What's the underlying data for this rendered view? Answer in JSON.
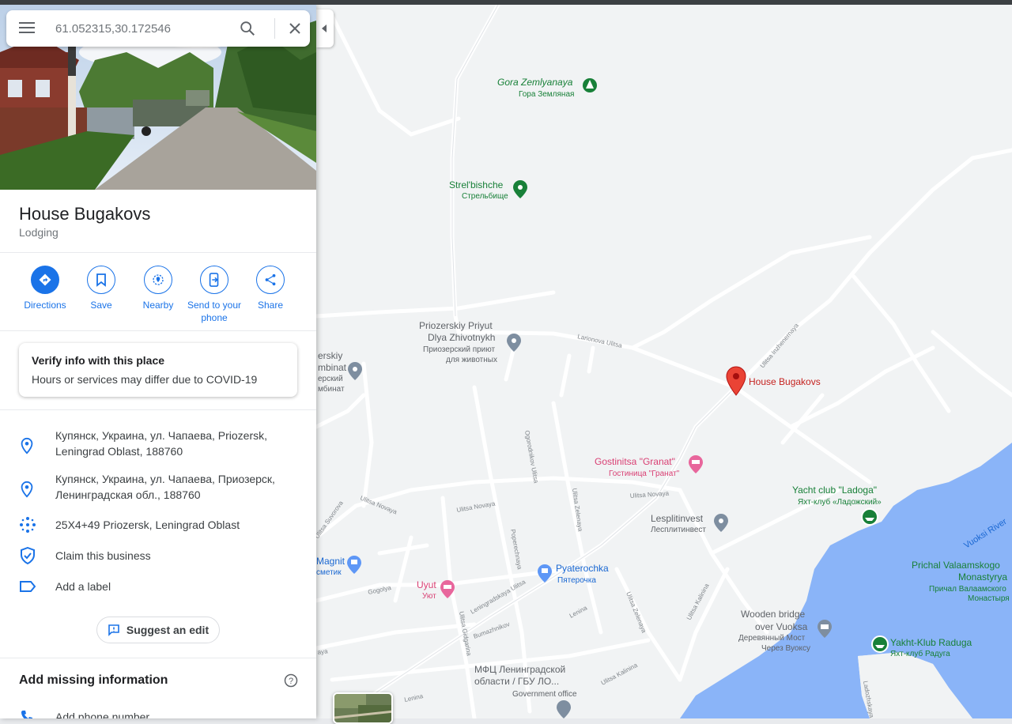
{
  "search": {
    "placeholder": "61.052315,30.172546"
  },
  "place": {
    "title": "House Bugakovs",
    "category": "Lodging"
  },
  "actions": [
    {
      "label": "Directions"
    },
    {
      "label": "Save"
    },
    {
      "label": "Nearby"
    },
    {
      "label": "Send to your\nphone"
    },
    {
      "label": "Share"
    }
  ],
  "verify": {
    "title": "Verify info with this place",
    "subtitle": "Hours or services may differ due to COVID-19"
  },
  "info": {
    "address_en": "Купянск, Украина, ул. Чапаева, Priozersk, Leningrad Oblast, 188760",
    "address_ru": "Купянск, Украина, ул. Чапаева, Приозерск, Ленинградская обл., 188760",
    "plus_code": "25X4+49 Priozersk, Leningrad Oblast",
    "claim": "Claim this business",
    "label": "Add a label"
  },
  "suggest_edit": "Suggest an edit",
  "missing": {
    "title": "Add missing information",
    "add_phone": "Add phone number"
  },
  "map": {
    "pois": {
      "gora_en": "Gora Zemlyanaya",
      "gora_ru": "Гора Земляная",
      "strel_en": "Strel'bishche",
      "strel_ru": "Стрельбище",
      "priyut_en1": "Priozerskiy Priyut",
      "priyut_en2": "Dlya Zhivotnykh",
      "priyut_ru1": "Приозерский приют",
      "priyut_ru2": "для животных",
      "kombinat_1": "erskiy",
      "kombinat_2": "mbinat",
      "kombinat_3": "ерский",
      "kombinat_4": "мбинат",
      "house": "House Bugakovs",
      "granat_en": "Gostinitsa \"Granat\"",
      "granat_ru": "Гостиница \"Гранат\"",
      "yacht_en": "Yacht club \"Ladoga\"",
      "yacht_ru": "Яхт-клуб «Ладожский»",
      "lesplit_en": "Lesplitinvest",
      "lesplit_ru": "Лесплитинвест",
      "magnit_en": "Magnit",
      "magnit_ru": "сметик",
      "pyat_en": "Pyaterochka",
      "pyat_ru": "Пятерочка",
      "uyut_en": "Uyut",
      "uyut_ru": "Уют",
      "bridge_en1": "Wooden bridge",
      "bridge_en2": "over Vuoksa",
      "bridge_ru1": "Деревянный Мост",
      "bridge_ru2": "Через Вуоксу",
      "raduga_en": "Yakht-Klub Raduga",
      "raduga_ru": "Яхт-клуб Радуга",
      "prichal_en1": "Prichal Valaamskogo",
      "prichal_en2": "Monastyrya",
      "prichal_ru1": "Причал Валаамского",
      "prichal_ru2": "Монастыря",
      "mfc_1": "МФЦ Ленинградской",
      "mfc_2": "области / ГБУ ЛО...",
      "mfc_3": "Government office",
      "river": "Vuoksi River"
    },
    "streets": {
      "larionova": "Larionova Ulitsa",
      "inzhenernaya": "Ulitsa Inzhenernaya",
      "ogorodnaya": "Ogorodnikov Ulitsa",
      "novaya1": "Ulitsa Novaya",
      "novaya2": "Ulitsa Novaya",
      "novaya3": "Ulitsa Novaya",
      "suvorova": "Ulitsa Suvorova",
      "zelenaya1": "Ulitsa Zelenaya",
      "zelenaya2": "Ulitsa Zelenaya",
      "poperechnaya": "Poperechnaya",
      "leningradskaya": "Leningradskaya Ulitsa",
      "lenina1": "Lenina",
      "lenina2": "Lenina",
      "gogolya": "Gogolya",
      "gidgarina": "Ulitsa Gidgarina",
      "bumazhnikov": "Bumazhnikov",
      "kalinina1": "Ulitsa Kalinina",
      "kalinina2": "Ulitsa Kalinina",
      "ladozhskaya": "Ladozhskaya",
      "aya": "aya"
    }
  },
  "colors": {
    "accent": "#1a73e8",
    "pin": "#ea4335",
    "poi_green": "#0f9d58",
    "poi_pink": "#d93f73",
    "water": "#8ab4f8",
    "land": "#f1f3f4"
  }
}
